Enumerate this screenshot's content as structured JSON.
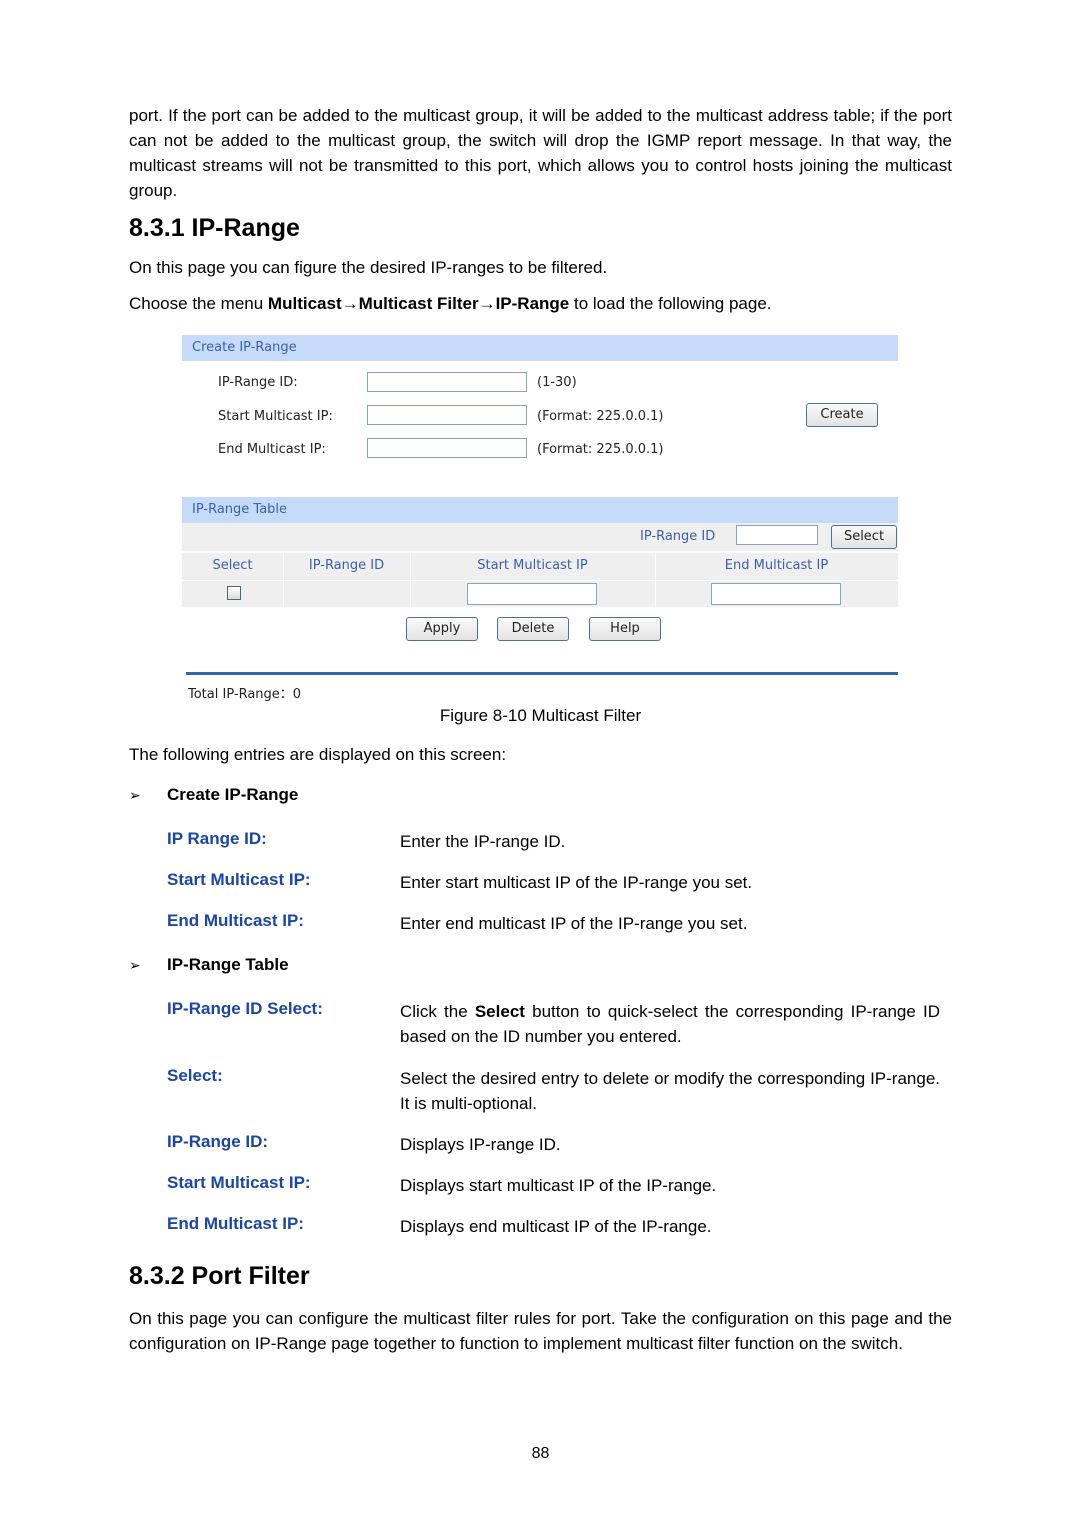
{
  "intro_paragraph": "port. If the port can be added to the multicast group, it will be added to the multicast address table; if the port can not be added to the multicast group, the switch will drop the IGMP report message. In that way, the multicast streams will not be transmitted to this port, which allows you to control hosts joining the multicast group.",
  "section_ip_range": {
    "heading": "8.3.1 IP-Range",
    "line1": "On this page you can figure the desired IP-ranges to be filtered.",
    "menu_prefix": "Choose the menu ",
    "menu_path_1": "Multicast",
    "arrow": "→",
    "menu_path_2": "Multicast Filter",
    "menu_path_3": "IP-Range",
    "menu_suffix": " to load the following page."
  },
  "figure": {
    "create_panel": {
      "title": "Create IP-Range",
      "fields": [
        {
          "label": "IP-Range ID:",
          "value": "",
          "hint": "(1-30)"
        },
        {
          "label": "Start Multicast IP:",
          "value": "",
          "hint": "(Format: 225.0.0.1)"
        },
        {
          "label": "End Multicast IP:",
          "value": "",
          "hint": "(Format: 225.0.0.1)"
        }
      ],
      "create_button": "Create"
    },
    "table_panel": {
      "title": "IP-Range Table",
      "search_label": "IP-Range ID",
      "search_value": "",
      "select_button": "Select",
      "columns": [
        "Select",
        "IP-Range ID",
        "Start Multicast IP",
        "End Multicast IP"
      ],
      "row": {
        "checked": false,
        "ip_range_id": "",
        "start_ip": "",
        "end_ip": ""
      },
      "buttons": {
        "apply": "Apply",
        "delete": "Delete",
        "help": "Help"
      },
      "total_label": "Total IP-Range：0"
    },
    "caption": "Figure 8-10 Multicast Filter"
  },
  "entries_intro": "The following entries are displayed on this screen:",
  "groups": [
    {
      "title": "Create IP-Range",
      "items": [
        {
          "term": "IP Range ID:",
          "desc": "Enter the IP-range ID."
        },
        {
          "term": "Start Multicast IP:",
          "desc": "Enter start multicast IP of the IP-range you set."
        },
        {
          "term": "End Multicast IP:",
          "desc": "Enter end multicast IP of the IP-range you set."
        }
      ]
    },
    {
      "title": "IP-Range Table",
      "items": [
        {
          "term": "IP-Range ID Select:",
          "desc_prefix": "Click the ",
          "desc_bold": "Select",
          "desc_suffix": " button to quick-select the corresponding IP-range ID based on the ID number you entered."
        },
        {
          "term": "Select:",
          "desc": "Select the desired entry to delete or modify the corresponding IP-range. It is multi-optional."
        },
        {
          "term": "IP-Range ID:",
          "desc": "Displays IP-range ID."
        },
        {
          "term": "Start Multicast IP:",
          "desc": "Displays start multicast IP of the IP-range."
        },
        {
          "term": "End Multicast IP:",
          "desc": "Displays end multicast IP of the IP-range."
        }
      ]
    }
  ],
  "section_port_filter": {
    "heading": "8.3.2 Port Filter",
    "body": "On this page you can configure the multicast filter rules for port. Take the configuration on this page and the configuration on IP-Range page together to function to implement multicast filter function on the switch."
  },
  "bullet_glyph": "➢",
  "page_number": "88"
}
